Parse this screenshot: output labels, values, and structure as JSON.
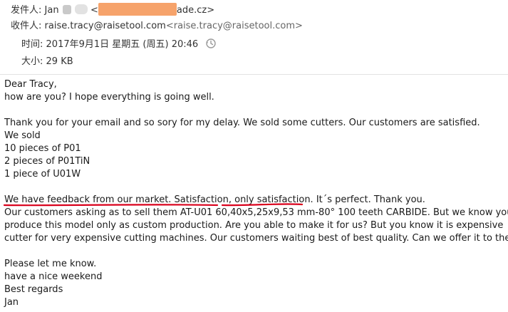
{
  "header": {
    "from_label": "发件人:",
    "from_name": "Jan",
    "from_email_suffix": "ade.cz>",
    "from_email_open": "<",
    "to_label": "收件人:",
    "to_name": "raise.tracy@raisetool.com",
    "to_email": "<raise.tracy@raisetool.com>",
    "time_label": "时间:",
    "time_value": "2017年9月1日 星期五 (周五) 20:46",
    "size_label": "大小:",
    "size_value": "29 KB"
  },
  "body": {
    "lines": [
      "Dear Tracy,",
      "how are you? I hope everything is going well.",
      "",
      "Thank you for your email and so sory for my delay. We sold some cutters. Our customers are satisfied.",
      "We sold",
      "10 pieces of P01",
      "2 pieces of P01TiN",
      "1 piece of U01W",
      "",
      "We have feedback from our market. Satisfaction, only satisfaction. It´s perfect. Thank you.",
      "Our customers asking as to sell them AT-U01 60,40x5,25x9,53 mm-80° 100 teeth CARBIDE. But we know you",
      "produce this model only as custom production. Are you able to make it for us? But you know it is expensive",
      "cutter for very expensive cutting machines. Our customers waiting best of best quality. Can we offer it to them?",
      "",
      "Please let me know.",
      "have a nice weekend",
      "Best regards",
      "Jan"
    ]
  },
  "colors": {
    "underline": "#d9001b",
    "redaction": "#f6a36b"
  },
  "icons": {
    "time": "clock-refresh-icon"
  }
}
